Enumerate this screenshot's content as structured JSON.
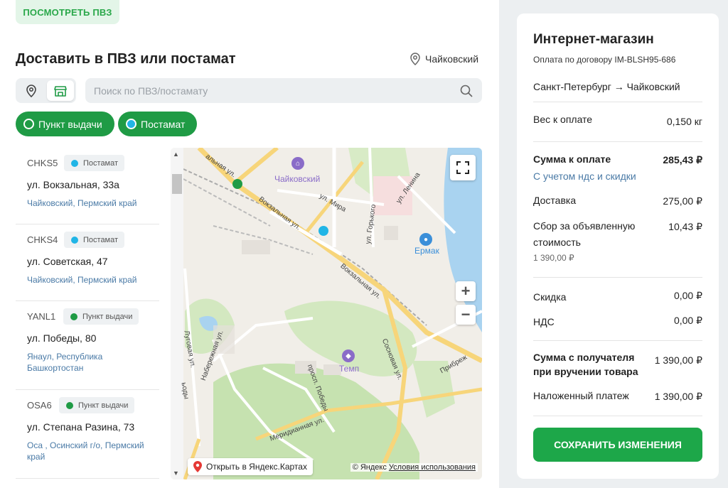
{
  "header": {
    "view_pvz_label": "ПОСМОТРЕТЬ ПВЗ",
    "title": "Доставить в ПВЗ или постамат",
    "city": "Чайковский"
  },
  "search": {
    "placeholder": "Поиск по ПВЗ/постамату",
    "value": ""
  },
  "filters": [
    {
      "label": "Пункт выдачи"
    },
    {
      "label": "Постамат"
    }
  ],
  "colors": {
    "pickup_point": "#1f9b45",
    "postamat": "#21b5e6",
    "accent": "#1da749"
  },
  "points": [
    {
      "code": "CHKS5",
      "type": "Постамат",
      "address": "ул. Вокзальная, 33а",
      "region": "Чайковский, Пермский край"
    },
    {
      "code": "CHKS4",
      "type": "Постамат",
      "address": "ул. Советская, 47",
      "region": "Чайковский, Пермский край"
    },
    {
      "code": "YANL1",
      "type": "Пункт выдачи",
      "address": "ул. Победы, 80",
      "region": "Янаул, Республика Башкортостан"
    },
    {
      "code": "OSA6",
      "type": "Пункт выдачи",
      "address": "ул. Степана Разина, 73",
      "region": "Оса , Осинский г/о, Пермский край"
    }
  ],
  "map": {
    "labels": {
      "city": "Чайковский",
      "ermak": "Ермак",
      "temp": "Темп",
      "vokzalnaya_1": "Вокзальная ул.",
      "vokzalnaya_2": "Вокзальная ул.",
      "mira": "ул. Мира",
      "gorkogo": "ул. Горького",
      "lenina": "ул. Ленина",
      "lugovaya": "Луговая ул.",
      "naberezhnaya": "Набережная ул.",
      "pobedy": "просп. Победы",
      "sosnovaya": "Сосновая ул.",
      "meridiannaya": "Меридианная ул.",
      "pribrezh": "Прибреж",
      "top_street": "альная ул.",
      "edge_street": "ьоды"
    },
    "open_in_yandex": "Открыть в Яндекс.Картах",
    "copyright": "© Яндекс",
    "terms": "Условия использования",
    "zoom_in": "+",
    "zoom_out": "−"
  },
  "order": {
    "shop": "Интернет-магазин",
    "contract": "Оплата по договору IM-BLSH95-686",
    "route": "Санкт-Петербург → Чайковский",
    "weight_label": "Вес к оплате",
    "weight_value": "0,150 кг",
    "sum_label": "Сумма к оплате",
    "sum_value": "285,43 ₽",
    "sum_note": "С учетом ндс и скидки",
    "delivery_label": "Доставка",
    "delivery_value": "275,00 ₽",
    "fee_label_1": "Сбор за объявленную",
    "fee_label_2": "стоимость",
    "fee_value": "10,43 ₽",
    "fee_note": "1 390,00 ₽",
    "discount_label": "Скидка",
    "discount_value": "0,00 ₽",
    "vat_label": "НДС",
    "vat_value": "0,00 ₽",
    "recipient_label_1": "Сумма с получателя",
    "recipient_label_2": "при вручении товара",
    "recipient_value": "1 390,00 ₽",
    "cod_label": "Наложенный платеж",
    "cod_value": "1 390,00 ₽",
    "save_label": "СОХРАНИТЬ ИЗМЕНЕНИЯ"
  }
}
